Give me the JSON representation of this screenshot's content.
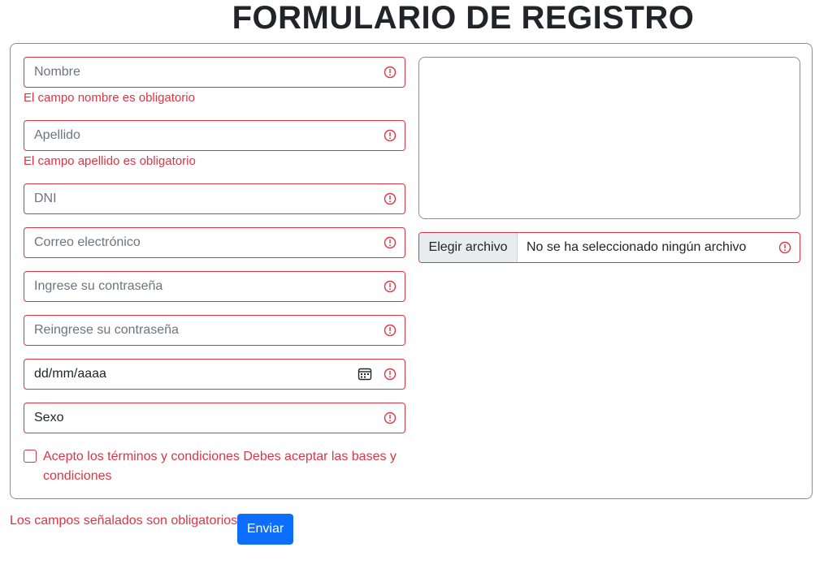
{
  "page": {
    "title": "FORMULARIO DE REGISTRO"
  },
  "form": {
    "nombre": {
      "placeholder": "Nombre",
      "error": "El campo nombre es obligatorio"
    },
    "apellido": {
      "placeholder": "Apellido",
      "error": "El campo apellido es obligatorio"
    },
    "dni": {
      "placeholder": "DNI"
    },
    "correo": {
      "placeholder": "Correo electrónico"
    },
    "password": {
      "placeholder": "Ingrese su contraseña"
    },
    "password_repeat": {
      "placeholder": "Reingrese su contraseña"
    },
    "fecha": {
      "value": "dd/mm/aaaa"
    },
    "sexo": {
      "value": "Sexo"
    },
    "terms": {
      "label": "Acepto los términos y condiciones",
      "error": "Debes aceptar las bases y condiciones"
    },
    "file": {
      "button_label": "Elegir archivo",
      "status": "No se ha seleccionado ningún archivo"
    },
    "footer_message": "Los campos señalados son obligatorios",
    "submit_label": "Enviar"
  },
  "colors": {
    "error": "#dc3545",
    "primary": "#0d6efd",
    "border": "#8e8e8e"
  },
  "icons": {
    "error": "exclamation-circle-icon",
    "calendar": "calendar-icon"
  }
}
